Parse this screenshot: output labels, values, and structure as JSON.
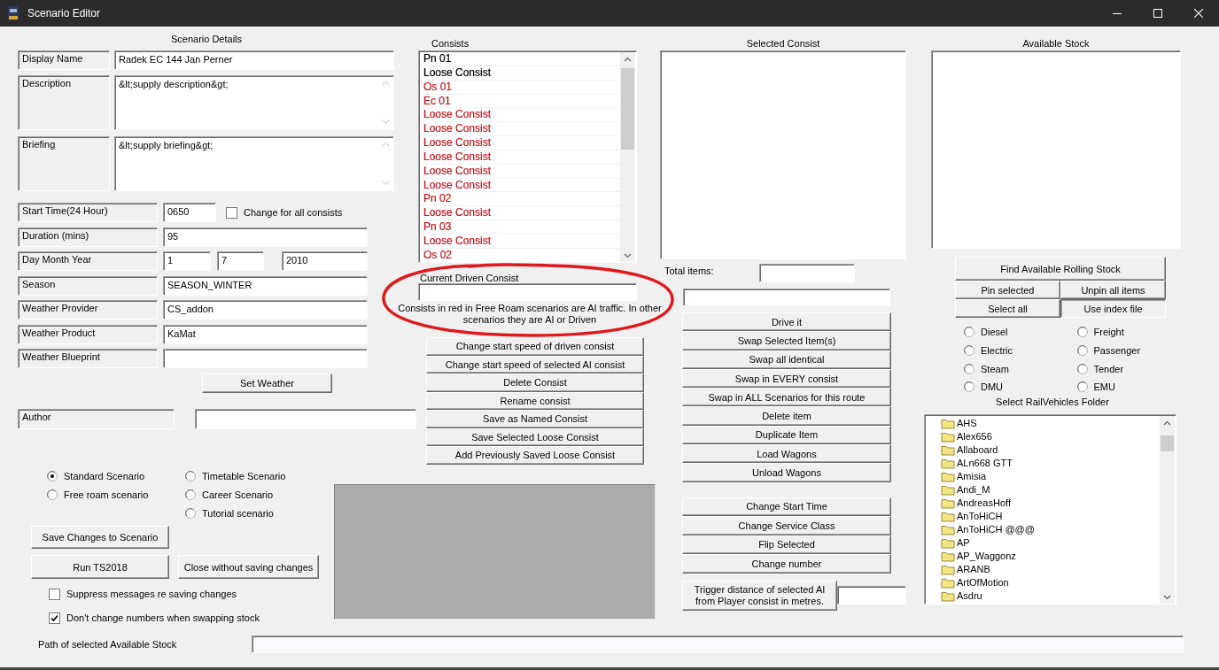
{
  "window": {
    "title": "Scenario Editor"
  },
  "scenario_details": {
    "heading": "Scenario Details",
    "text_fields": [
      {
        "label": "Display Name",
        "value": "Radek EC 144 Jan Perner",
        "kind": "line"
      },
      {
        "label": "Description",
        "value": "&lt;supply description&gt;",
        "kind": "memo"
      },
      {
        "label": "Briefing",
        "value": "&lt;supply briefing&gt;",
        "kind": "memo"
      }
    ],
    "settings": [
      {
        "label": "Start Time(24 Hour)",
        "kind": "time",
        "values": [
          "0650"
        ],
        "option": {
          "label": "Change for all consists",
          "checked": false
        }
      },
      {
        "label": "Duration (mins)",
        "kind": "single",
        "values": [
          "95"
        ]
      },
      {
        "label": "Day Month Year",
        "kind": "date",
        "values": [
          "1",
          "7",
          "2010"
        ]
      },
      {
        "label": "Season",
        "kind": "single",
        "values": [
          "SEASON_WINTER"
        ]
      },
      {
        "label": "Weather Provider",
        "kind": "single",
        "values": [
          "CS_addon"
        ]
      },
      {
        "label": "Weather Product",
        "kind": "single",
        "values": [
          "KaMat"
        ]
      },
      {
        "label": "Weather Blueprint",
        "kind": "single"
      }
    ],
    "set_weather_button": "Set Weather",
    "author": {
      "label": "Author"
    }
  },
  "scenario_type_columns": [
    {
      "options": [
        {
          "label": "Standard Scenario",
          "selected": true
        },
        {
          "label": "Free roam scenario",
          "selected": false
        }
      ]
    },
    {
      "options": [
        {
          "label": "Timetable Scenario",
          "selected": false
        },
        {
          "label": "Career Scenario",
          "selected": false
        },
        {
          "label": "Tutorial scenario",
          "selected": false
        }
      ]
    }
  ],
  "action_buttons": [
    "Save Changes to Scenario",
    "Run TS2018",
    "Close without saving changes"
  ],
  "options": [
    {
      "label": "Suppress messages re saving changes",
      "checked": false
    },
    {
      "label": "Don't change numbers when swapping stock",
      "checked": true
    }
  ],
  "path": {
    "label": "Path of selected Available Stock"
  },
  "consists": {
    "heading": "Consists",
    "items": [
      {
        "name": "Pn 01",
        "color": "#000000"
      },
      {
        "name": "Loose Consist",
        "color": "#000000"
      },
      {
        "name": "Os 01",
        "color": "#c4161c"
      },
      {
        "name": "Ec 01",
        "color": "#c4161c"
      },
      {
        "name": "Loose Consist",
        "color": "#c4161c"
      },
      {
        "name": "Loose Consist",
        "color": "#c4161c"
      },
      {
        "name": "Loose Consist",
        "color": "#c4161c"
      },
      {
        "name": "Loose Consist",
        "color": "#c4161c"
      },
      {
        "name": "Loose Consist",
        "color": "#c4161c"
      },
      {
        "name": "Loose Consist",
        "color": "#c4161c"
      },
      {
        "name": "Pn 02",
        "color": "#c4161c"
      },
      {
        "name": "Loose Consist",
        "color": "#c4161c"
      },
      {
        "name": "Pn 03",
        "color": "#c4161c"
      },
      {
        "name": "Loose Consist",
        "color": "#c4161c"
      },
      {
        "name": "Os 02",
        "color": "#c4161c"
      }
    ]
  },
  "driven_consist": {
    "label": "Current Driven Consist",
    "note": "Consists in red in Free Roam scenarios are AI traffic. In other scenarios they are AI or Driven"
  },
  "consist_buttons": [
    "Change start speed of driven consist",
    "Change start speed of selected AI consist",
    "Delete Consist",
    "Rename consist",
    "Save as Named Consist",
    "Save Selected Loose Consist",
    "Add Previously Saved Loose Consist"
  ],
  "selected_consist": {
    "heading": "Selected Consist",
    "total_label": "Total items:",
    "button_groups": [
      {
        "buttons": [
          "Drive it",
          "Swap Selected Item(s)",
          "Swap all identical",
          "Swap in EVERY consist",
          "Swap in ALL Scenarios for this route",
          "Delete item",
          "Duplicate Item",
          "Load Wagons",
          "Unload Wagons"
        ]
      },
      {
        "buttons": [
          "Change Start Time",
          "Change Service Class",
          "Flip Selected",
          "Change number"
        ]
      }
    ],
    "trigger_button": "Trigger distance of selected AI from Player consist in metres."
  },
  "available_stock": {
    "heading": "Available Stock",
    "find_button": "Find Available Rolling Stock",
    "tool_buttons": [
      {
        "label": "Pin selected",
        "pressed": false
      },
      {
        "label": "Unpin all items",
        "pressed": false
      },
      {
        "label": "Select all",
        "pressed": false
      },
      {
        "label": "Use index file",
        "pressed": true
      }
    ],
    "filter_columns": [
      {
        "options": [
          {
            "label": "Diesel",
            "selected": false
          },
          {
            "label": "Electric",
            "selected": false
          },
          {
            "label": "Steam",
            "selected": false
          },
          {
            "label": "DMU",
            "selected": false
          }
        ]
      },
      {
        "options": [
          {
            "label": "Freight",
            "selected": false
          },
          {
            "label": "Passenger",
            "selected": false
          },
          {
            "label": "Tender",
            "selected": false
          },
          {
            "label": "EMU",
            "selected": false
          }
        ]
      }
    ],
    "folder_heading": "Select RailVehicles Folder",
    "folders": [
      "AHS",
      "Alex656",
      "Allaboard",
      "ALn668 GTT",
      "Amisia",
      "Andi_M",
      "AndreasHoff",
      "AnToHiCH",
      "AnToHiCH @@@",
      "AP",
      "AP_Waggonz",
      "ARANB",
      "ArtOfMotion",
      "Asdru"
    ]
  }
}
